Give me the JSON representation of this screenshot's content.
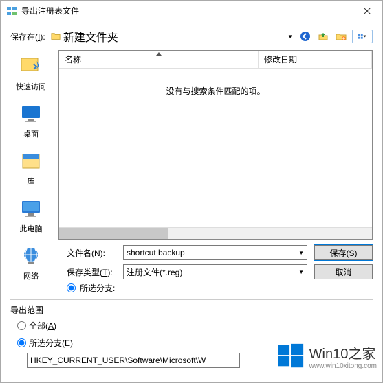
{
  "window": {
    "title": "导出注册表文件",
    "close_tooltip": "关闭"
  },
  "save_in": {
    "label_pre": "保存在(",
    "label_hotkey": "I",
    "label_post": "):",
    "selected": "新建文件夹"
  },
  "toolbar_icons": [
    "back-icon",
    "up-icon",
    "new-folder-icon",
    "view-menu-icon"
  ],
  "sidebar": {
    "items": [
      {
        "id": "quick",
        "label": "快速访问"
      },
      {
        "id": "desktop",
        "label": "桌面"
      },
      {
        "id": "libraries",
        "label": "库"
      },
      {
        "id": "thispc",
        "label": "此电脑"
      },
      {
        "id": "network",
        "label": "网络"
      }
    ]
  },
  "columns": {
    "name": "名称",
    "modified": "修改日期"
  },
  "empty_message": "没有与搜索条件匹配的项。",
  "filename": {
    "label_pre": "文件名(",
    "label_hotkey": "N",
    "label_post": "):",
    "value": "shortcut backup"
  },
  "filetype": {
    "label_pre": "保存类型(",
    "label_hotkey": "T",
    "label_post": "):",
    "value": "注册文件(*.reg)"
  },
  "branch_radio": "所选分支:",
  "buttons": {
    "save_pre": "保存(",
    "save_hotkey": "S",
    "save_post": ")",
    "cancel": "取消"
  },
  "export_scope": {
    "legend": "导出范围",
    "all_pre": "全部(",
    "all_hotkey": "A",
    "all_post": ")",
    "branch_pre": "所选分支(",
    "branch_hotkey": "E",
    "branch_post": ")",
    "branch_path": "HKEY_CURRENT_USER\\Software\\Microsoft\\W"
  },
  "watermark": {
    "main": "Win10之家",
    "sub": "www.win10xitong.com"
  }
}
